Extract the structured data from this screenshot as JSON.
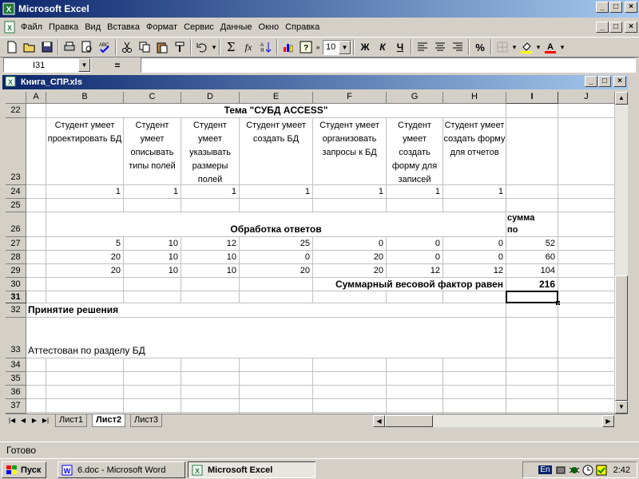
{
  "app": {
    "title": "Microsoft Excel"
  },
  "menu": [
    "Файл",
    "Правка",
    "Вид",
    "Вставка",
    "Формат",
    "Сервис",
    "Данные",
    "Окно",
    "Справка"
  ],
  "toolbar": {
    "sum_symbol": "Σ",
    "fx_symbol": "fx",
    "percent_symbol": "%",
    "font_size": "10",
    "bold_label": "Ж",
    "italic_label": "К",
    "underline_label": "Ч",
    "icons": [
      "new-icon",
      "open-icon",
      "save-icon",
      "print-icon",
      "preview-icon",
      "spelling-icon",
      "cut-icon",
      "copy-icon",
      "paste-icon",
      "format-painter-icon",
      "undo-icon",
      "sum-icon",
      "function-icon",
      "sort-icon",
      "chart-icon",
      "help-icon"
    ]
  },
  "formula_bar": {
    "name_box": "I31",
    "equals": "=",
    "value": ""
  },
  "workbook": {
    "title": "Книга_СПР.xls"
  },
  "columns": [
    "A",
    "B",
    "C",
    "D",
    "E",
    "F",
    "G",
    "H",
    "I",
    "J"
  ],
  "rows": {
    "r22": {
      "num": "22",
      "title": "Тема \"СУБД ACCESS\""
    },
    "r23": {
      "num": "23",
      "headers": [
        "Студент умеет проектировать БД",
        "Студент умеет описывать типы полей",
        "Студент умеет указывать размеры полей",
        "Студент умеет создать БД",
        "Студент умеет организовать запросы к БД",
        "Студент умеет создать форму для записей",
        "Студент умеет создать форму для отчетов"
      ]
    },
    "r24": {
      "num": "24",
      "values": [
        "1",
        "1",
        "1",
        "1",
        "1",
        "1",
        "1"
      ]
    },
    "r25": {
      "num": "25"
    },
    "r26": {
      "num": "26",
      "label": "Обработка ответов",
      "summa_line1": "сумма",
      "summa_line2": "по"
    },
    "r27": {
      "num": "27",
      "values": [
        "5",
        "10",
        "12",
        "25",
        "0",
        "0",
        "0"
      ],
      "total": "52"
    },
    "r28": {
      "num": "28",
      "values": [
        "20",
        "10",
        "10",
        "0",
        "20",
        "0",
        "0"
      ],
      "total": "60"
    },
    "r29": {
      "num": "29",
      "values": [
        "20",
        "10",
        "10",
        "20",
        "20",
        "12",
        "12"
      ],
      "total": "104"
    },
    "r30": {
      "num": "30",
      "label": "Суммарный весовой фактор равен",
      "total": "216"
    },
    "r31": {
      "num": "31"
    },
    "r32": {
      "num": "32",
      "label": "Принятие решения"
    },
    "r33": {
      "num": "33",
      "label": "Аттестован по разделу БД"
    },
    "r34": {
      "num": "34"
    },
    "r35": {
      "num": "35"
    },
    "r36": {
      "num": "36"
    },
    "r37": {
      "num": "37"
    }
  },
  "sheets": {
    "list1": "Лист1",
    "list2": "Лист2",
    "list3": "Лист3"
  },
  "status": {
    "text": "Готово"
  },
  "taskbar": {
    "start": "Пуск",
    "word_doc": "6.doc - Microsoft Word",
    "excel": "Microsoft Excel",
    "lang": "En",
    "time": "2:42"
  }
}
